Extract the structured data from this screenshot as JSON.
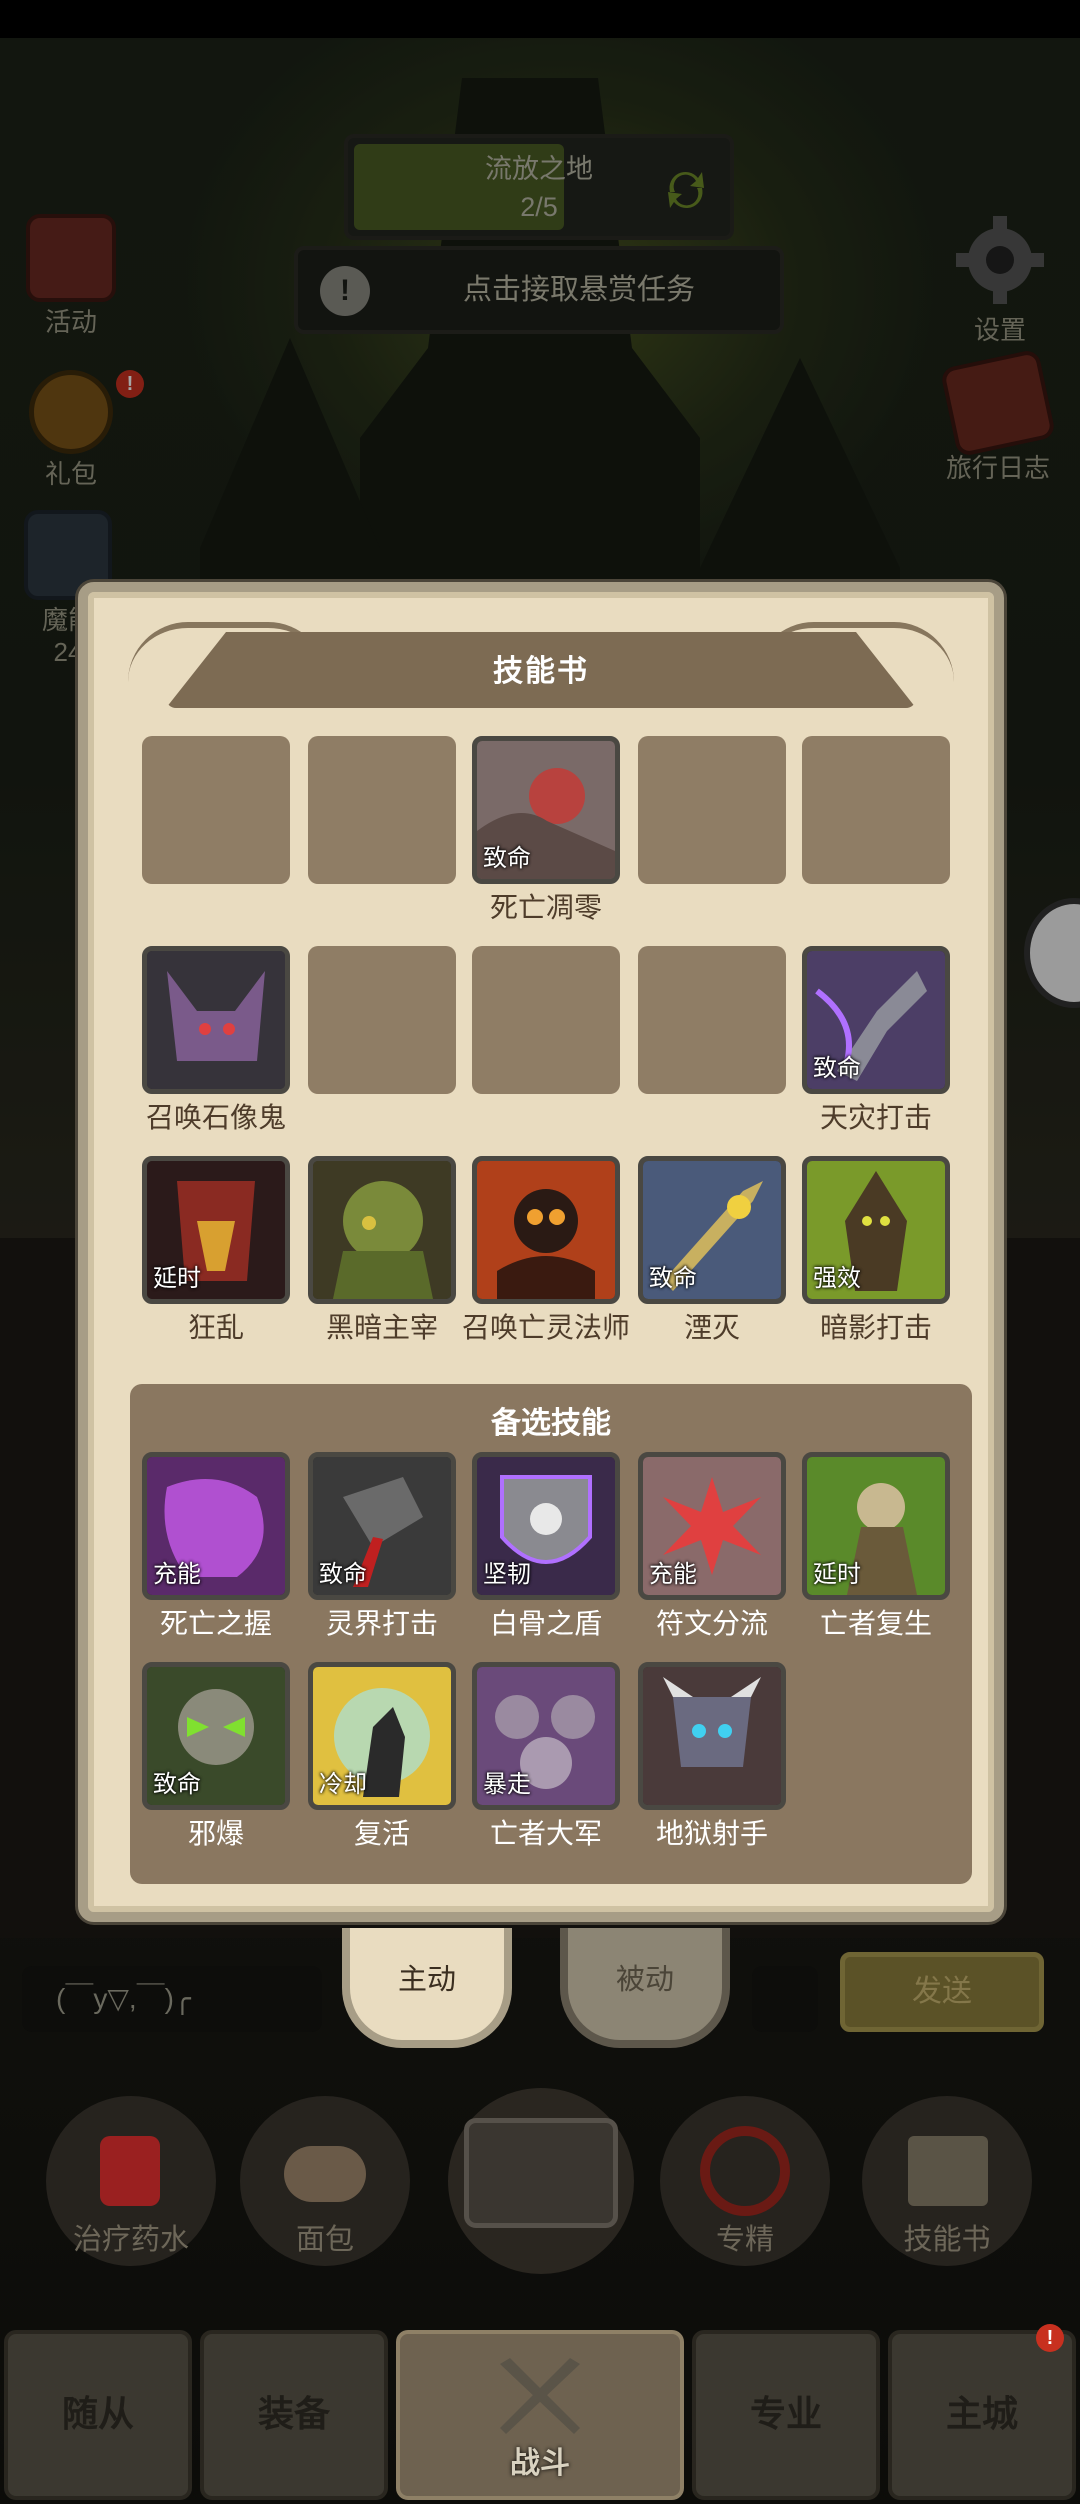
{
  "map": {
    "name": "流放之地",
    "progress": "2/5"
  },
  "quest": {
    "text": "点击接取悬赏任务"
  },
  "left_side": {
    "activity": "活动",
    "gift": "礼包",
    "partial_1": "魔能",
    "partial_2": "24"
  },
  "right_side": {
    "settings": "设置",
    "journal": "旅行日志"
  },
  "skill_book": {
    "title": "技能书",
    "rows": [
      [
        null,
        null,
        {
          "name": "死亡凋零",
          "tag": "致命"
        },
        null,
        null
      ],
      [
        {
          "name": "召唤石像鬼",
          "tag": ""
        },
        null,
        null,
        null,
        {
          "name": "天灾打击",
          "tag": "致命"
        }
      ],
      [
        {
          "name": "狂乱",
          "tag": "延时"
        },
        {
          "name": "黑暗主宰",
          "tag": ""
        },
        {
          "name": "召唤亡灵法师",
          "tag": ""
        },
        {
          "name": "湮灭",
          "tag": "致命"
        },
        {
          "name": "暗影打击",
          "tag": "强效"
        }
      ]
    ]
  },
  "alternate": {
    "title": "备选技能",
    "row1": [
      {
        "name": "死亡之握",
        "tag": "充能"
      },
      {
        "name": "灵界打击",
        "tag": "致命"
      },
      {
        "name": "白骨之盾",
        "tag": "坚韧"
      },
      {
        "name": "符文分流",
        "tag": "充能"
      },
      {
        "name": "亡者复生",
        "tag": "延时"
      }
    ],
    "row2": [
      {
        "name": "邪爆",
        "tag": "致命"
      },
      {
        "name": "复活",
        "tag": "冷却"
      },
      {
        "name": "亡者大军",
        "tag": "暴走"
      },
      {
        "name": "地狱射手",
        "tag": ""
      }
    ]
  },
  "tabs": {
    "active": "主动",
    "passive": "被动"
  },
  "chat": {
    "emoticon": "(￣y▽,￣)╭",
    "send": "发送"
  },
  "actions": {
    "potion": "治疗药水",
    "bread": "面包",
    "mastery": "专精",
    "skillbook": "技能书"
  },
  "nav": {
    "followers": "随从",
    "equipment": "装备",
    "battle": "战斗",
    "profession": "专业",
    "city": "主城"
  },
  "badges": {
    "gift": "!",
    "city": "!"
  },
  "colors": {
    "panel": "#e9dcc0",
    "header": "#7d6b53",
    "slot_empty": "#8a7760",
    "alert": "#c8301f"
  },
  "icons": {
    "refresh": "refresh-icon",
    "gear": "gear-icon",
    "book": "journal-icon",
    "crossed_swords": "crossed-swords-icon"
  }
}
